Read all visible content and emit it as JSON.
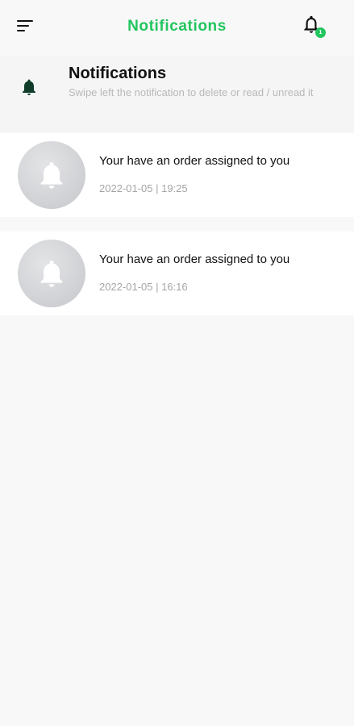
{
  "colors": {
    "accent": "#22c55e",
    "badge": "#22c55e",
    "dark_icon": "#0f3d2a"
  },
  "appbar": {
    "title": "Notifications",
    "menu_icon": "menu-icon",
    "bell_icon": "bell-icon",
    "badge_count": "1"
  },
  "info": {
    "icon": "bell-icon",
    "title": "Notifications",
    "subtitle": "Swipe left the notification to delete or read / unread it"
  },
  "notifications": [
    {
      "icon": "bell-icon",
      "title": "Your have an order assigned to you",
      "timestamp": "2022-01-05 | 19:25"
    },
    {
      "icon": "bell-icon",
      "title": "Your have an order assigned to you",
      "timestamp": "2022-01-05 | 16:16"
    }
  ]
}
